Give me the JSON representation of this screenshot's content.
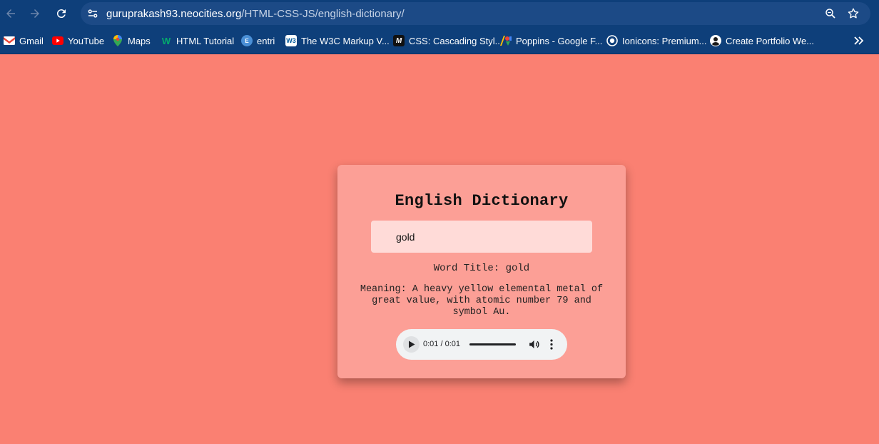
{
  "browser": {
    "url_host": "guruprakash93.neocities.org",
    "url_path": "/HTML-CSS-JS/english-dictionary/",
    "bookmarks": [
      {
        "label": "Gmail",
        "icon": "gmail-icon"
      },
      {
        "label": "YouTube",
        "icon": "youtube-icon"
      },
      {
        "label": "Maps",
        "icon": "maps-icon"
      },
      {
        "label": "HTML Tutorial",
        "icon": "w3schools-icon"
      },
      {
        "label": "entri",
        "icon": "entri-icon"
      },
      {
        "label": "The W3C Markup V...",
        "icon": "w3c-icon"
      },
      {
        "label": "CSS: Cascading Styl...",
        "icon": "mdn-icon"
      },
      {
        "label": "Poppins - Google F...",
        "icon": "google-fonts-icon"
      },
      {
        "label": "Ionicons: Premium...",
        "icon": "ionicons-icon"
      },
      {
        "label": "Create Portfolio We...",
        "icon": "portfolio-icon"
      }
    ]
  },
  "app": {
    "title": "English Dictionary",
    "search_value": "gold",
    "word_title": "Word Title: gold",
    "meaning": "Meaning: A heavy yellow elemental metal of great value, with atomic number 79 and symbol Au.",
    "audio": {
      "time": "0:01 / 0:01",
      "progress": 1.0
    }
  },
  "colors": {
    "page_bg": "#fa8072",
    "card_bg": "#fc9f96",
    "input_bg": "#ffdbd8",
    "chrome_bg": "#0e3f7a"
  }
}
